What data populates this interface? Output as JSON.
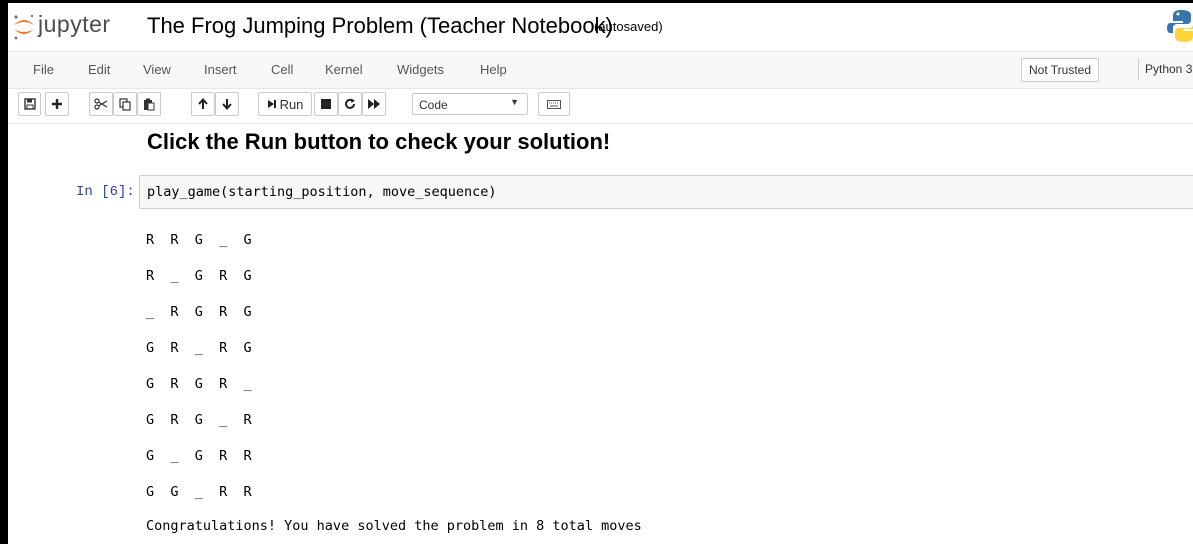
{
  "header": {
    "logo_text": "jupyter",
    "notebook_title": "The Frog Jumping Problem (Teacher Notebook)",
    "autosave_status": "(autosaved)"
  },
  "menubar": {
    "items": [
      "File",
      "Edit",
      "View",
      "Insert",
      "Cell",
      "Kernel",
      "Widgets",
      "Help"
    ],
    "trust_status": "Not Trusted",
    "kernel_name": "Python 3"
  },
  "toolbar": {
    "run_label": "Run",
    "cell_type": "Code",
    "icons": [
      "save-icon",
      "plus-icon",
      "scissors-icon",
      "copy-icon",
      "paste-icon",
      "arrow-up-icon",
      "arrow-down-icon",
      "step-forward-icon",
      "stop-icon",
      "restart-icon",
      "fast-forward-icon",
      "keyboard-icon"
    ]
  },
  "notebook": {
    "heading": "Click the Run button to check your solution!",
    "cell": {
      "prompt": "In [6]:",
      "source": "play_game(starting_position, move_sequence)",
      "output_lines": [
        "R R G _ G",
        "R _ G R G",
        "_ R G R G",
        "G R _ R G",
        "G R G R _",
        "G R G _ R",
        "G _ G R R",
        "G G _ R R"
      ],
      "result_message": "Congratulations! You have solved the problem in 8 total moves"
    }
  },
  "colors": {
    "prompt_blue": "#303f9f",
    "jupyter_orange": "#f37726",
    "python_blue": "#3776ab",
    "python_yellow": "#ffd43b"
  }
}
